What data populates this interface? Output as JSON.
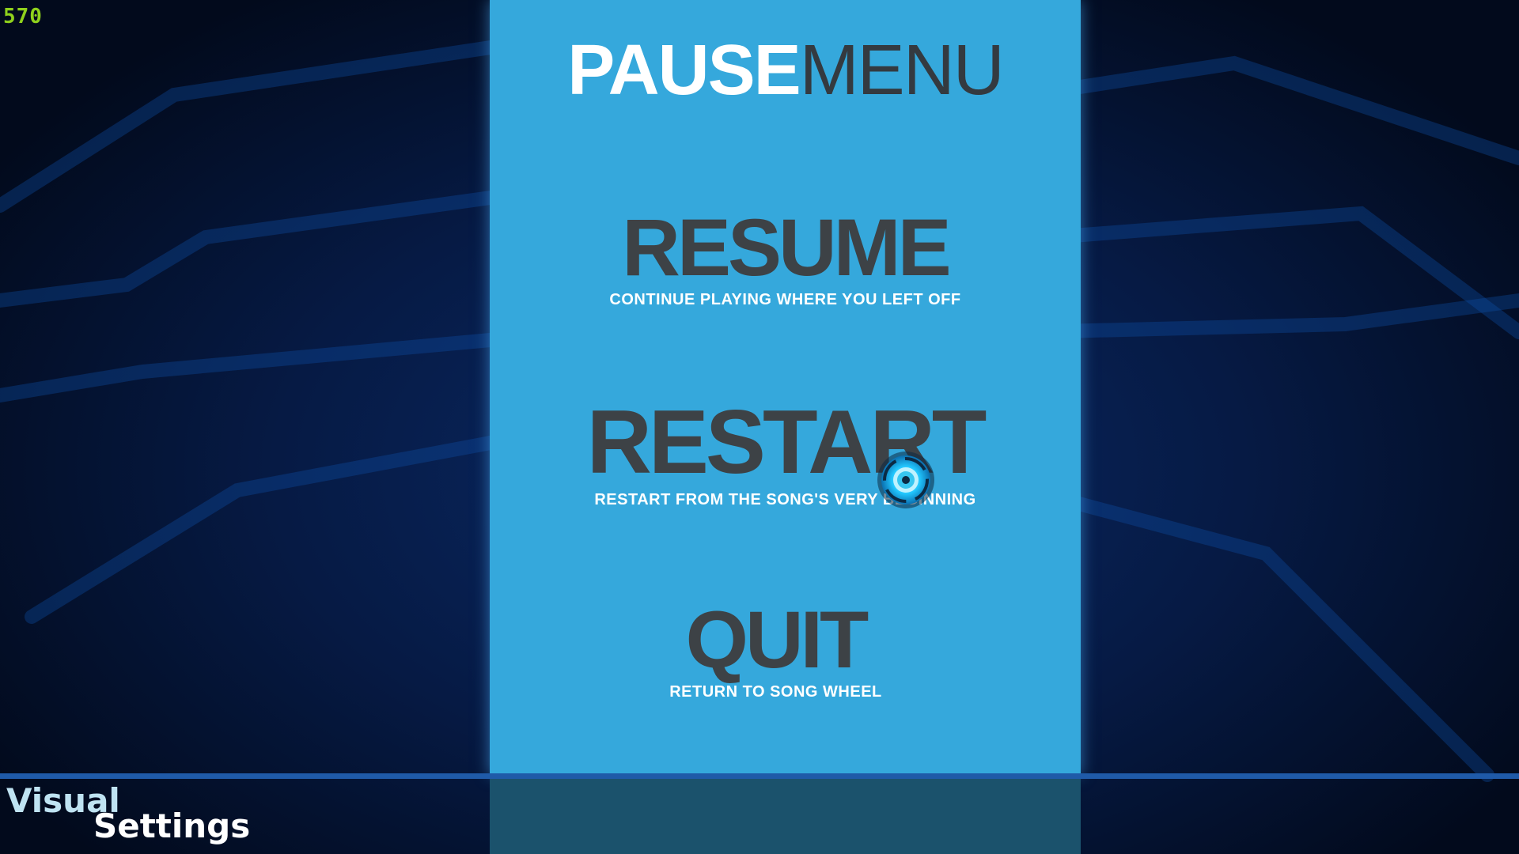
{
  "hud": {
    "fps": "570"
  },
  "menu": {
    "title_part1": "PAUSE",
    "title_part2": "MENU",
    "options": [
      {
        "label": "RESUME",
        "description": "CONTINUE PLAYING WHERE YOU LEFT OFF"
      },
      {
        "label": "RESTART",
        "description": "RESTART FROM THE SONG'S VERY BEGINNING"
      },
      {
        "label": "QUIT",
        "description": "RETURN TO SONG WHEEL"
      }
    ]
  },
  "footer": {
    "line1": "Visual",
    "line2": "Settings"
  },
  "colors": {
    "panel": "#35a8dc",
    "option_text": "#3d4246",
    "fps_text": "#8fd11c",
    "cursor_glow": "#22c8ff"
  },
  "icons": {
    "cursor": "glowing-ring-cursor-icon"
  }
}
